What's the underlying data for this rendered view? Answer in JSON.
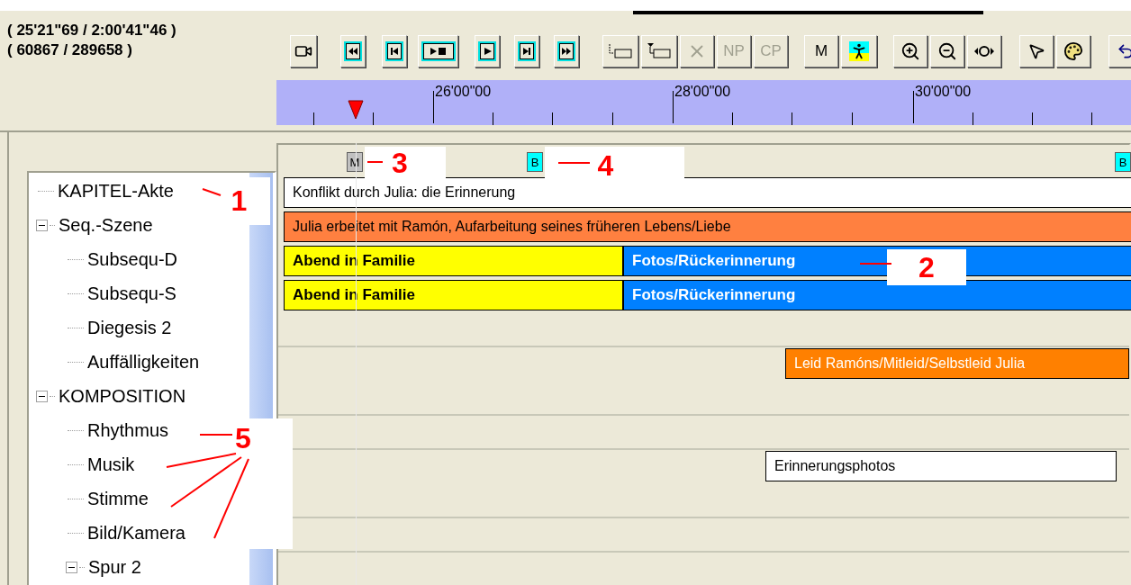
{
  "position": {
    "time": "( 25'21\"69 / 2:00'41\"46 )",
    "frame": "( 60867 / 289658 )"
  },
  "toolbar": {
    "text_buttons": [
      {
        "label": "NP",
        "disabled": true
      },
      {
        "label": "CP",
        "disabled": true
      },
      {
        "label": "M",
        "disabled": false
      }
    ]
  },
  "ruler": {
    "labels": [
      "26'00\"00",
      "28'00\"00",
      "30'00\"00"
    ]
  },
  "tree": [
    {
      "label": "KAPITEL-Akte"
    },
    {
      "label": "Seq.-Szene",
      "expanded": true,
      "children": [
        {
          "label": "Subsequ-D"
        },
        {
          "label": "Subsequ-S"
        },
        {
          "label": "Diegesis 2"
        },
        {
          "label": "Auffälligkeiten"
        }
      ]
    },
    {
      "label": "KOMPOSITION",
      "expanded": true,
      "children": [
        {
          "label": "Rhythmus"
        },
        {
          "label": "Musik"
        },
        {
          "label": "Stimme"
        },
        {
          "label": "Bild/Kamera"
        },
        {
          "label": "Spur 2",
          "expanded": true
        }
      ]
    }
  ],
  "markers": [
    {
      "label": "M",
      "color": "#c0c0c0"
    },
    {
      "label": "B",
      "color": "#00ffff"
    },
    {
      "label": "B",
      "color": "#00ffff"
    }
  ],
  "tracks": [
    {
      "segments": [
        {
          "text": "Konflikt durch Julia: die Erinnerung",
          "color": "#ffffff",
          "kind": "plain"
        }
      ]
    },
    {
      "segments": [
        {
          "text": "Julia erbeitet mit Ramón, Aufarbeitung seines früheren Lebens/Liebe",
          "color": "#ff8040",
          "kind": "plain"
        }
      ]
    },
    {
      "segments": [
        {
          "text": "Abend in Familie",
          "color": "#ffff00",
          "kind": "bold"
        },
        {
          "text": "Fotos/Rückerinnerung",
          "color": "#0080ff",
          "kind": "bold"
        }
      ]
    },
    {
      "segments": [
        {
          "text": "Abend in Familie",
          "color": "#ffff00",
          "kind": "bold"
        },
        {
          "text": "Fotos/Rückerinnerung",
          "color": "#0080ff",
          "kind": "bold"
        }
      ]
    },
    {
      "kind": "empty"
    },
    {
      "segments": [
        {
          "text": "Leid Ramóns/Mitleid/Selbstleid Julia",
          "color": "#ff8000",
          "kind": "plain"
        }
      ]
    },
    {
      "kind": "empty"
    },
    {
      "kind": "empty"
    },
    {
      "segments": [
        {
          "text": "Erinnerungsphotos",
          "color": "#ffffff",
          "kind": "plain"
        }
      ]
    },
    {
      "kind": "empty"
    },
    {
      "kind": "empty"
    },
    {
      "kind": "empty"
    }
  ],
  "annotations": [
    {
      "label": "1"
    },
    {
      "label": "3"
    },
    {
      "label": "4"
    },
    {
      "label": "2"
    },
    {
      "label": "5"
    }
  ]
}
